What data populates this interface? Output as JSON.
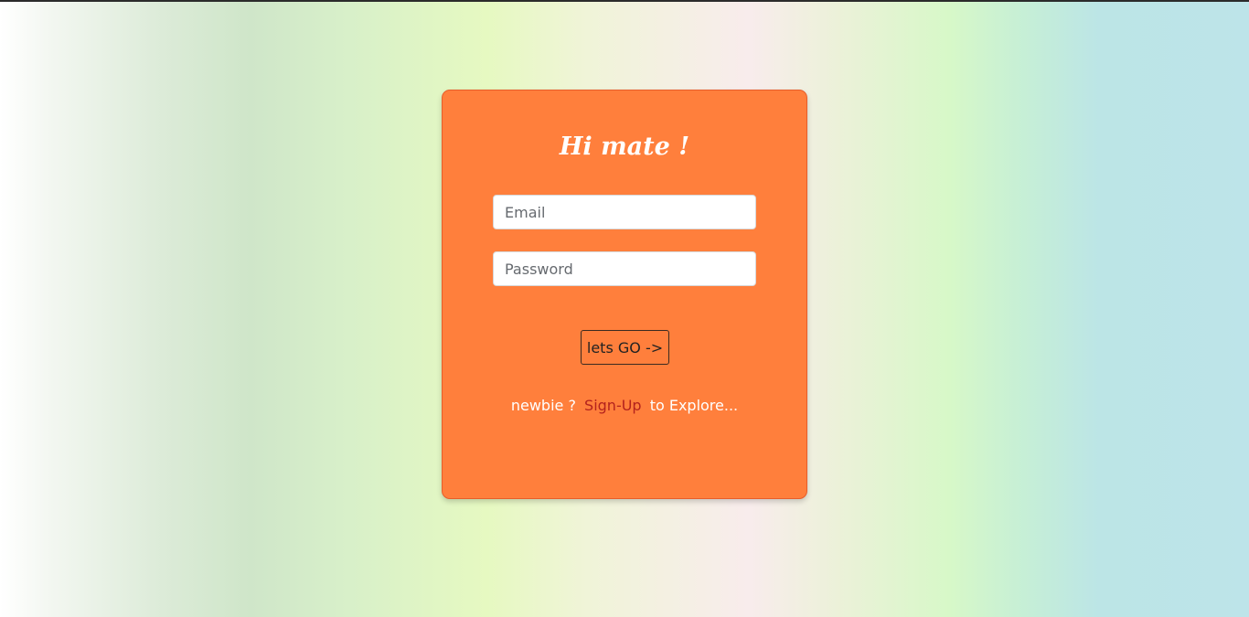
{
  "card": {
    "title": "Hi mate !",
    "email_placeholder": "Email",
    "password_placeholder": "Password",
    "submit_label": "lets GO ->",
    "signup_prefix": "newbie ?",
    "signup_link": "Sign-Up",
    "signup_suffix": "to Explore..."
  },
  "colors": {
    "card_background": "#ff7f3c",
    "link": "#b3221d"
  }
}
